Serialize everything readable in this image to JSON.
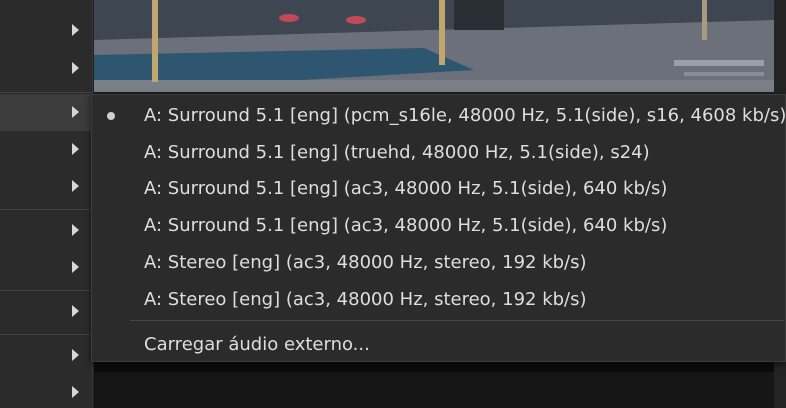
{
  "audio_menu": {
    "selected_index": 0,
    "tracks": [
      {
        "label": "A: Surround 5.1 [eng] (pcm_s16le, 48000 Hz, 5.1(side), s16, 4608 kb/s)"
      },
      {
        "label": "A: Surround 5.1 [eng] (truehd, 48000 Hz, 5.1(side), s24)"
      },
      {
        "label": "A: Surround 5.1 [eng] (ac3, 48000 Hz, 5.1(side), 640 kb/s)"
      },
      {
        "label": "A: Surround 5.1 [eng] (ac3, 48000 Hz, 5.1(side), 640 kb/s)"
      },
      {
        "label": "A: Stereo [eng] (ac3, 48000 Hz, stereo, 192 kb/s)"
      },
      {
        "label": "A: Stereo [eng] (ac3, 48000 Hz, stereo, 192 kb/s)"
      }
    ],
    "load_external_label": "Carregar áudio externo...",
    "selected_indicator_icon": "radio-dot-icon"
  },
  "parent_menu": {
    "submenu_arrow_icon": "chevron-right-icon",
    "active_row_index": 2
  },
  "colors": {
    "menu_bg": "#2b2b2b",
    "menu_text": "#dedede",
    "active_row": "#3c3c3c"
  }
}
